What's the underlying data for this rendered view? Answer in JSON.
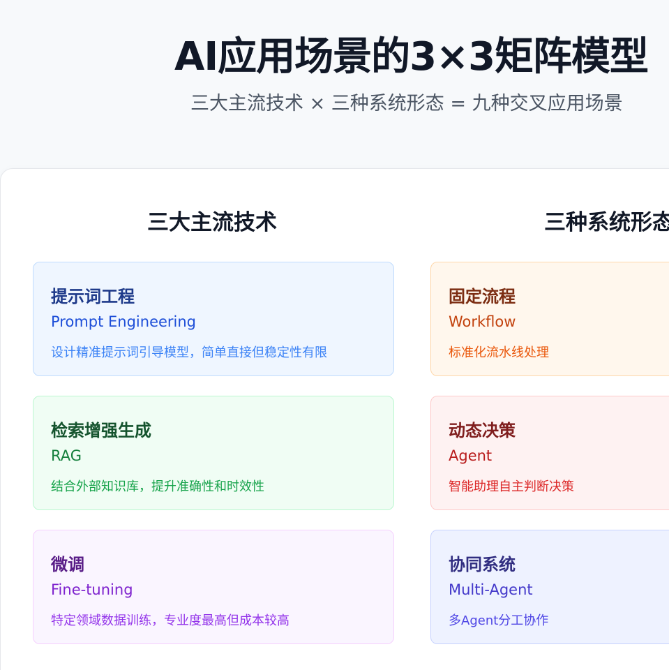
{
  "header": {
    "title": "AI应用场景的3×3矩阵模型",
    "subtitle": "三大主流技术 × 三种系统形态 = 九种交叉应用场景"
  },
  "technologies": {
    "heading": "三大主流技术",
    "items": [
      {
        "title": "提示词工程",
        "subtitle": "Prompt Engineering",
        "desc": "设计精准提示词引导模型，简单直接但稳定性有限",
        "theme": "blue"
      },
      {
        "title": "检索增强生成",
        "subtitle": "RAG",
        "desc": "结合外部知识库，提升准确性和时效性",
        "theme": "green"
      },
      {
        "title": "微调",
        "subtitle": "Fine-tuning",
        "desc": "特定领域数据训练，专业度最高但成本较高",
        "theme": "purple"
      }
    ]
  },
  "systems": {
    "heading": "三种系统形态",
    "items": [
      {
        "title": "固定流程",
        "subtitle": "Workflow",
        "desc": "标准化流水线处理",
        "theme": "orange"
      },
      {
        "title": "动态决策",
        "subtitle": "Agent",
        "desc": "智能助理自主判断决策",
        "theme": "red"
      },
      {
        "title": "协同系统",
        "subtitle": "Multi-Agent",
        "desc": "多Agent分工协作",
        "theme": "indigo"
      }
    ]
  },
  "colors": {
    "page_background": "#f7f9fb",
    "panel_background": "#ffffff",
    "title_text": "#111827",
    "subtitle_text": "#4b5563"
  }
}
